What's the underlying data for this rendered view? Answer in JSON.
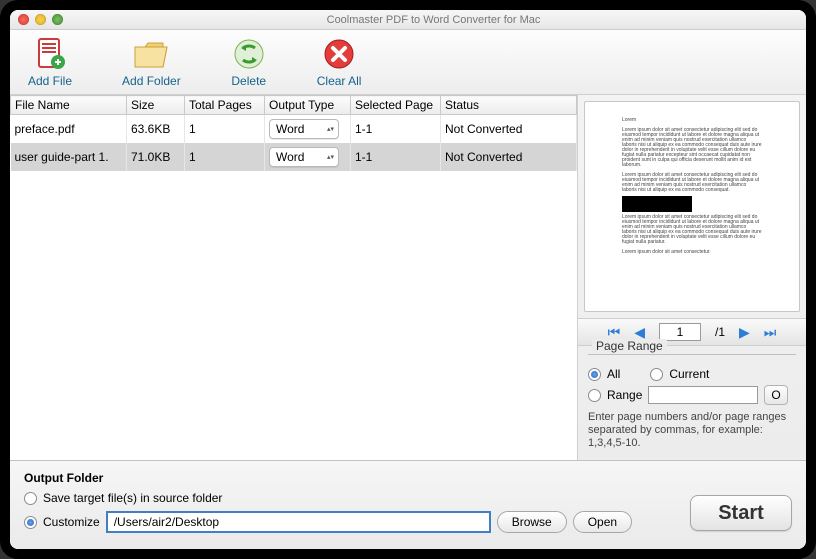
{
  "window": {
    "title": "Coolmaster PDF to Word Converter for Mac"
  },
  "toolbar": {
    "add_file": "Add File",
    "add_folder": "Add Folder",
    "delete": "Delete",
    "clear_all": "Clear All"
  },
  "table": {
    "columns": {
      "file_name": "File Name",
      "size": "Size",
      "total_pages": "Total Pages",
      "output_type": "Output Type",
      "selected_page": "Selected Page",
      "status": "Status"
    },
    "rows": [
      {
        "file_name": "preface.pdf",
        "size": "63.6KB",
        "total_pages": "1",
        "output_type": "Word",
        "selected_page": "1-1",
        "status": "Not Converted"
      },
      {
        "file_name": "user guide-part 1.",
        "size": "71.0KB",
        "total_pages": "1",
        "output_type": "Word",
        "selected_page": "1-1",
        "status": "Not Converted"
      }
    ]
  },
  "pager": {
    "current": "1",
    "separator": "/",
    "total": "1"
  },
  "page_range": {
    "legend": "Page Range",
    "all": "All",
    "current": "Current",
    "range": "Range",
    "range_value": "",
    "ok": "O",
    "hint": "Enter page numbers and/or page ranges separated by commas, for example: 1,3,4,5-10.",
    "selected": "all"
  },
  "output_folder": {
    "title": "Output Folder",
    "save_source": "Save target file(s) in source folder",
    "customize": "Customize",
    "path": "/Users/air2/Desktop",
    "browse": "Browse",
    "open": "Open",
    "selected": "customize"
  },
  "start_label": "Start"
}
